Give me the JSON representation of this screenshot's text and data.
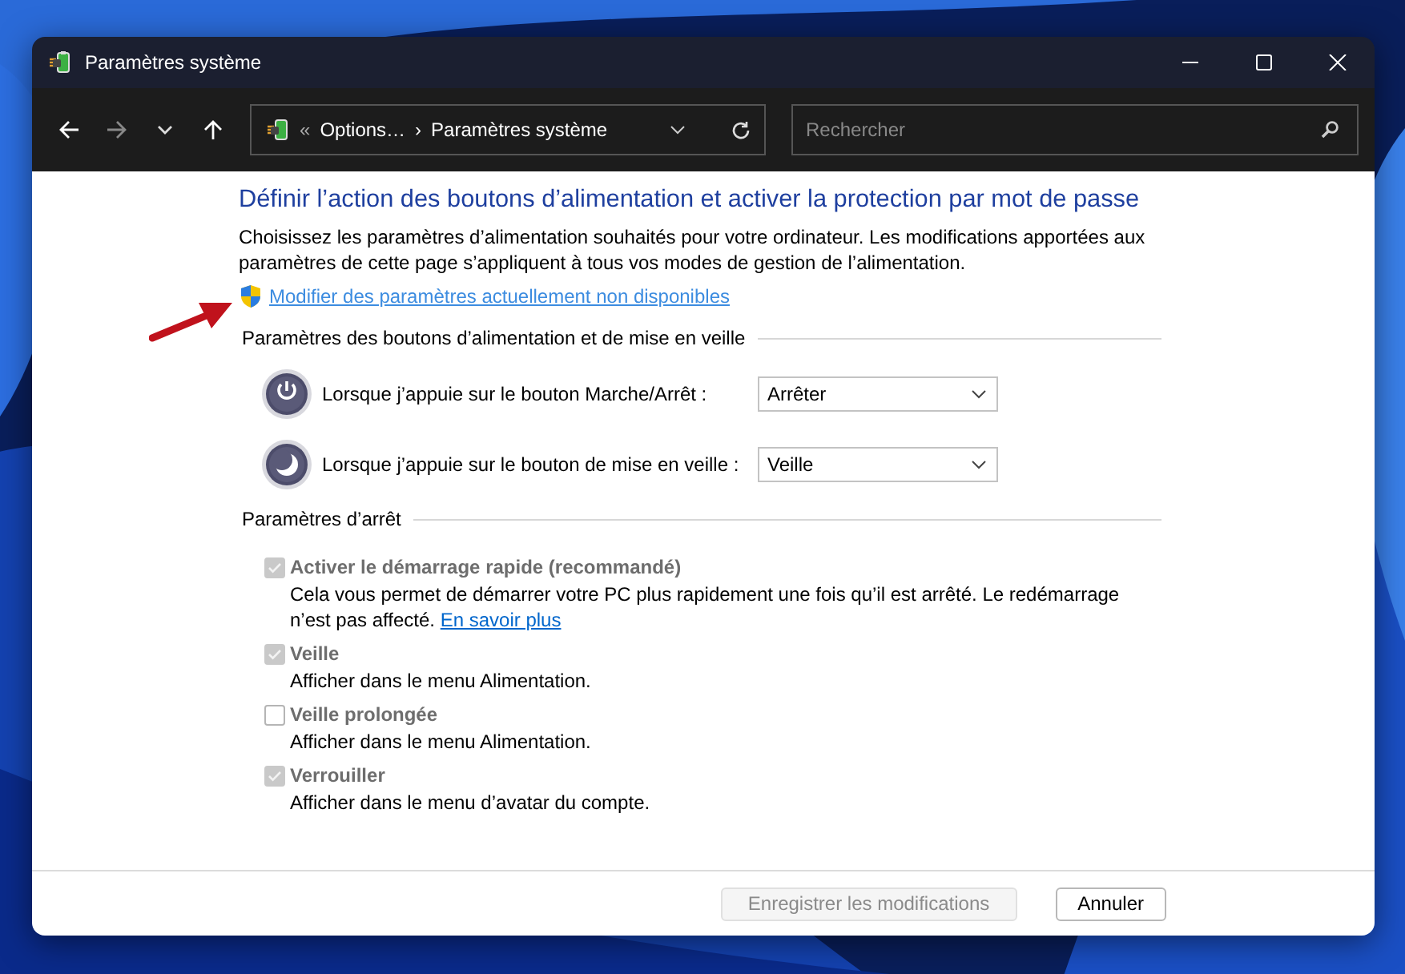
{
  "window": {
    "title": "Paramètres système"
  },
  "address_bar": {
    "prefix": "«",
    "crumbs": [
      "Options…",
      "Paramètres système"
    ],
    "separator": "›"
  },
  "search": {
    "placeholder": "Rechercher"
  },
  "heading": "Définir l’action des boutons d’alimentation et activer la protection par mot de passe",
  "description": "Choisissez les paramètres d’alimentation souhaités pour votre ordinateur. Les modifications apportées aux paramètres de cette page s’appliquent à tous vos modes de gestion de l’alimentation.",
  "admin_link": "Modifier des paramètres actuellement non disponibles",
  "sections": [
    {
      "kind": "buttons",
      "title": "Paramètres des boutons d’alimentation et de mise en veille",
      "rows": [
        {
          "kind": "power",
          "label": "Lorsque j’appuie sur le bouton Marche/Arrêt :",
          "value": "Arrêter"
        },
        {
          "kind": "sleep",
          "label": "Lorsque j’appuie sur le bouton de mise en veille :",
          "value": "Veille"
        }
      ]
    },
    {
      "kind": "options",
      "title": "Paramètres d’arrêt",
      "options": [
        {
          "label": "Activer le démarrage rapide (recommandé)",
          "checked": true,
          "disabled": true,
          "description": "Cela vous permet de démarrer votre PC plus rapidement une fois qu’il est arrêté. Le redémarrage n’est pas affecté.",
          "link": "En savoir plus"
        },
        {
          "label": "Veille",
          "checked": true,
          "disabled": true,
          "description": "Afficher dans le menu Alimentation."
        },
        {
          "label": "Veille prolongée",
          "checked": false,
          "disabled": true,
          "description": "Afficher dans le menu Alimentation."
        },
        {
          "label": "Verrouiller",
          "checked": true,
          "disabled": true,
          "description": "Afficher dans le menu d’avatar du compte."
        }
      ]
    }
  ],
  "footer_buttons": [
    {
      "label": "Enregistrer les modifications",
      "disabled": true
    },
    {
      "label": "Annuler",
      "disabled": false
    }
  ]
}
